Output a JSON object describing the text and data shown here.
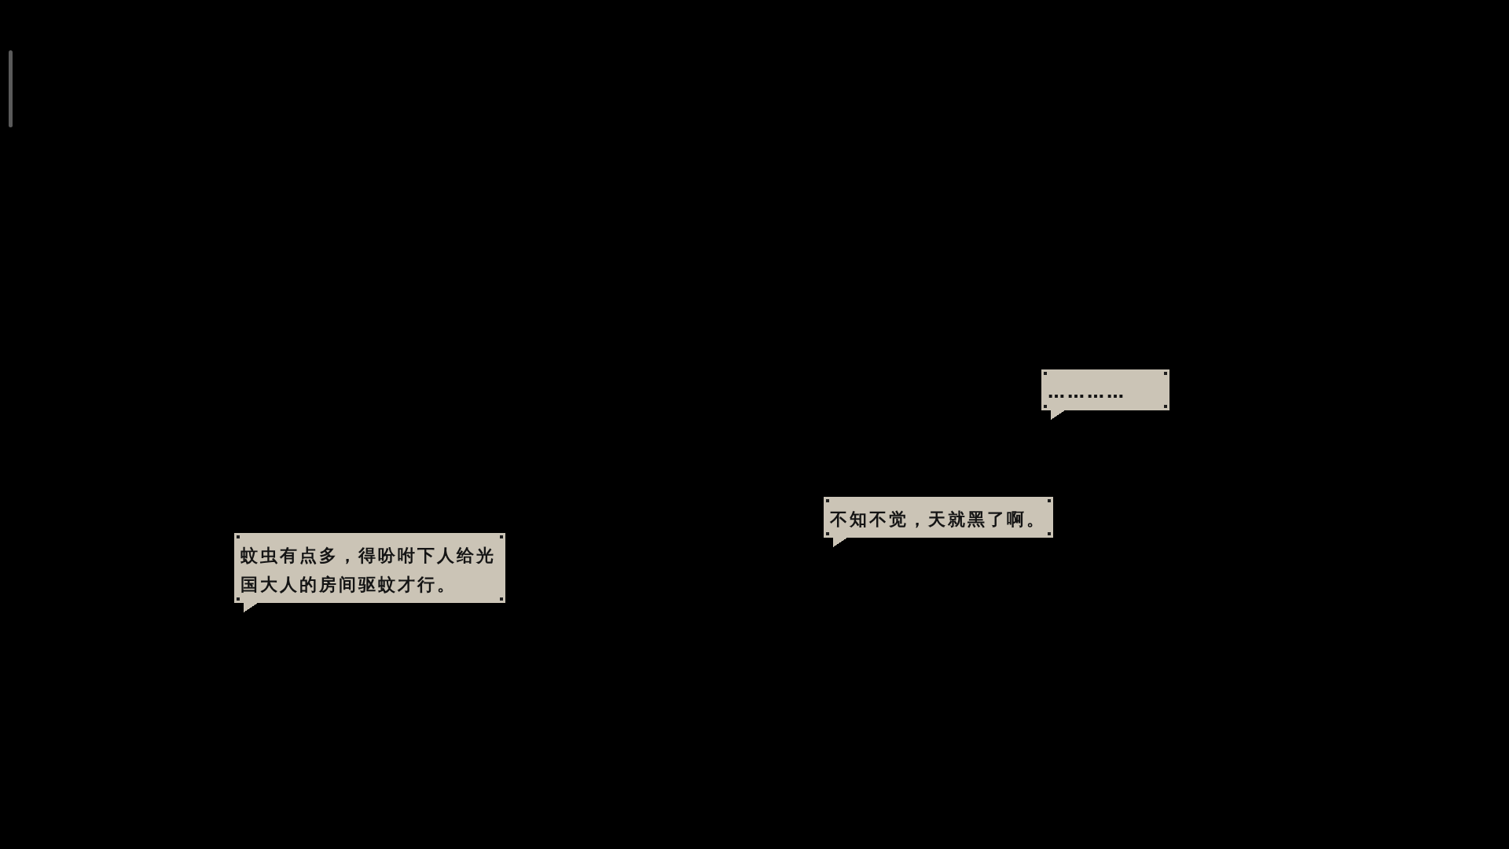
{
  "scene": {
    "speech_bubbles": [
      {
        "text": "蚊虫有点多，得吩咐下人给光国大人的房间驱蚊才行。"
      },
      {
        "text": "不知不觉，天就黑了啊。"
      },
      {
        "text": "…………"
      }
    ]
  }
}
